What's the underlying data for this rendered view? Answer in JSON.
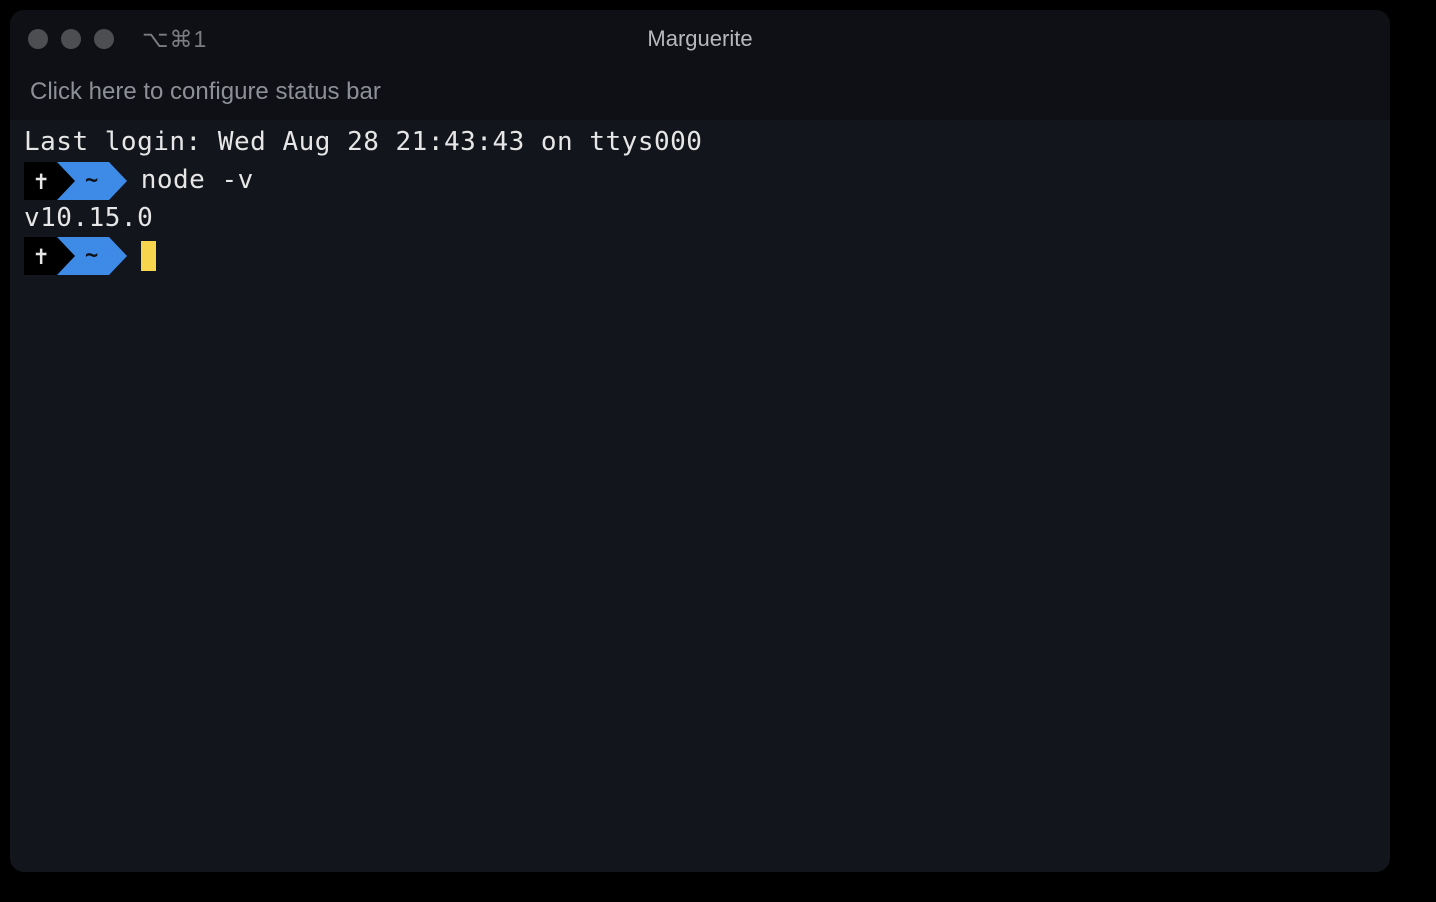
{
  "titlebar": {
    "shortcut": "⌥⌘1",
    "title": "Marguerite"
  },
  "status_bar": {
    "text": "Click here to configure status bar"
  },
  "terminal": {
    "last_login": "Last login: Wed Aug 28 21:43:43 on ttys000",
    "prompt_segments": {
      "status_icon": "✝",
      "path": "~"
    },
    "command1": "node -v",
    "output1": "v10.15.0"
  }
}
